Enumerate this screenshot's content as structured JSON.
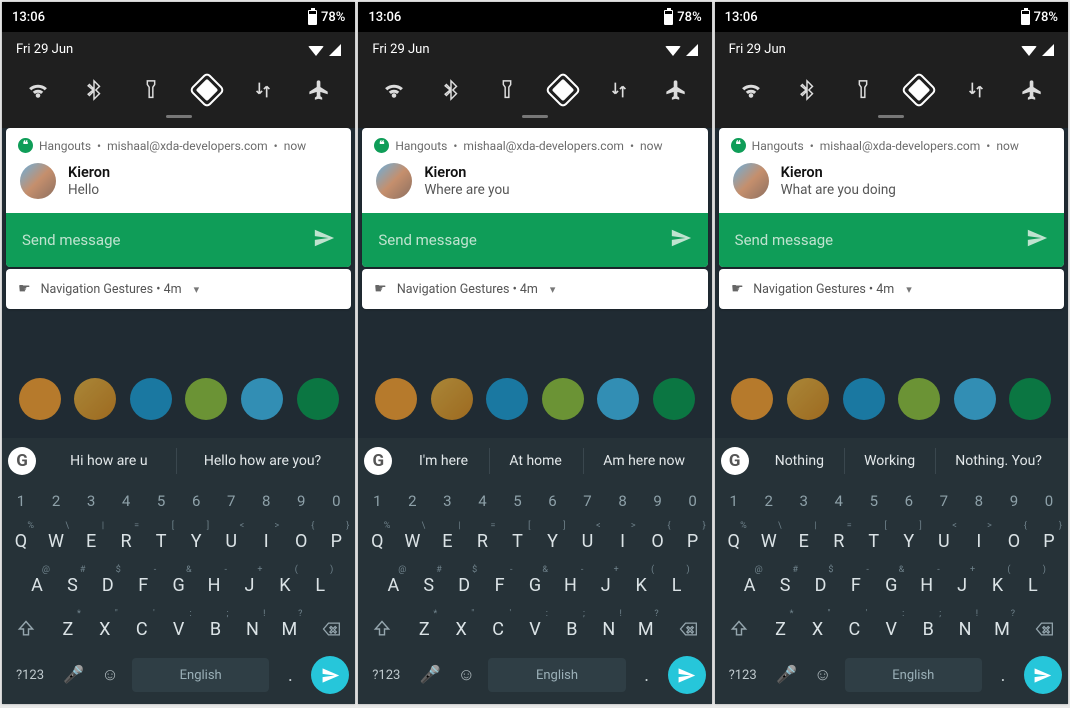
{
  "screens": [
    {
      "status": {
        "time": "13:06",
        "battery": "78%"
      },
      "qs": {
        "date": "Fri 29 Jun"
      },
      "notification": {
        "app": "Hangouts",
        "account": "mishaal@xda-developers.com",
        "when": "now",
        "sender": "Kieron",
        "message": "Hello",
        "reply_placeholder": "Send message"
      },
      "lower": {
        "title": "Navigation Gestures",
        "age": "4m"
      },
      "keyboard": {
        "suggestions": [
          "Hi how are u",
          "Hello how are you?"
        ],
        "numbers": [
          "1",
          "2",
          "3",
          "4",
          "5",
          "6",
          "7",
          "8",
          "9",
          "0"
        ],
        "row1": [
          {
            "k": "Q",
            "h": "%"
          },
          {
            "k": "W",
            "h": "\\"
          },
          {
            "k": "E",
            "h": "|"
          },
          {
            "k": "R",
            "h": "="
          },
          {
            "k": "T",
            "h": "["
          },
          {
            "k": "Y",
            "h": "]"
          },
          {
            "k": "U",
            "h": "<"
          },
          {
            "k": "I",
            "h": ">"
          },
          {
            "k": "O",
            "h": "{"
          },
          {
            "k": "P",
            "h": "}"
          }
        ],
        "row2": [
          {
            "k": "A",
            "h": "@"
          },
          {
            "k": "S",
            "h": "#"
          },
          {
            "k": "D",
            "h": "$"
          },
          {
            "k": "F",
            "h": "-"
          },
          {
            "k": "G",
            "h": "&"
          },
          {
            "k": "H",
            "h": "-"
          },
          {
            "k": "J",
            "h": "+"
          },
          {
            "k": "K",
            "h": "("
          },
          {
            "k": "L",
            "h": ")"
          }
        ],
        "row3": [
          {
            "k": "Z",
            "h": "*"
          },
          {
            "k": "X",
            "h": "\""
          },
          {
            "k": "C",
            "h": "'"
          },
          {
            "k": "V",
            "h": ":"
          },
          {
            "k": "B",
            "h": ";"
          },
          {
            "k": "N",
            "h": "!"
          },
          {
            "k": "M",
            "h": "?"
          }
        ],
        "sym": "?123",
        "space": "English",
        "dot": "."
      }
    },
    {
      "status": {
        "time": "13:06",
        "battery": "78%"
      },
      "qs": {
        "date": "Fri 29 Jun"
      },
      "notification": {
        "app": "Hangouts",
        "account": "mishaal@xda-developers.com",
        "when": "now",
        "sender": "Kieron",
        "message": "Where are you",
        "reply_placeholder": "Send message"
      },
      "lower": {
        "title": "Navigation Gestures",
        "age": "4m"
      },
      "keyboard": {
        "suggestions": [
          "I'm here",
          "At home",
          "Am here now"
        ],
        "numbers": [
          "1",
          "2",
          "3",
          "4",
          "5",
          "6",
          "7",
          "8",
          "9",
          "0"
        ],
        "row1": [
          {
            "k": "Q",
            "h": "%"
          },
          {
            "k": "W",
            "h": "\\"
          },
          {
            "k": "E",
            "h": "|"
          },
          {
            "k": "R",
            "h": "="
          },
          {
            "k": "T",
            "h": "["
          },
          {
            "k": "Y",
            "h": "]"
          },
          {
            "k": "U",
            "h": "<"
          },
          {
            "k": "I",
            "h": ">"
          },
          {
            "k": "O",
            "h": "{"
          },
          {
            "k": "P",
            "h": "}"
          }
        ],
        "row2": [
          {
            "k": "A",
            "h": "@"
          },
          {
            "k": "S",
            "h": "#"
          },
          {
            "k": "D",
            "h": "$"
          },
          {
            "k": "F",
            "h": "-"
          },
          {
            "k": "G",
            "h": "&"
          },
          {
            "k": "H",
            "h": "-"
          },
          {
            "k": "J",
            "h": "+"
          },
          {
            "k": "K",
            "h": "("
          },
          {
            "k": "L",
            "h": ")"
          }
        ],
        "row3": [
          {
            "k": "Z",
            "h": "*"
          },
          {
            "k": "X",
            "h": "\""
          },
          {
            "k": "C",
            "h": "'"
          },
          {
            "k": "V",
            "h": ":"
          },
          {
            "k": "B",
            "h": ";"
          },
          {
            "k": "N",
            "h": "!"
          },
          {
            "k": "M",
            "h": "?"
          }
        ],
        "sym": "?123",
        "space": "English",
        "dot": "."
      }
    },
    {
      "status": {
        "time": "13:06",
        "battery": "78%"
      },
      "qs": {
        "date": "Fri 29 Jun"
      },
      "notification": {
        "app": "Hangouts",
        "account": "mishaal@xda-developers.com",
        "when": "now",
        "sender": "Kieron",
        "message": "What are you doing",
        "reply_placeholder": "Send message"
      },
      "lower": {
        "title": "Navigation Gestures",
        "age": "4m"
      },
      "keyboard": {
        "suggestions": [
          "Nothing",
          "Working",
          "Nothing. You?"
        ],
        "numbers": [
          "1",
          "2",
          "3",
          "4",
          "5",
          "6",
          "7",
          "8",
          "9",
          "0"
        ],
        "row1": [
          {
            "k": "Q",
            "h": "%"
          },
          {
            "k": "W",
            "h": "\\"
          },
          {
            "k": "E",
            "h": "|"
          },
          {
            "k": "R",
            "h": "="
          },
          {
            "k": "T",
            "h": "["
          },
          {
            "k": "Y",
            "h": "]"
          },
          {
            "k": "U",
            "h": "<"
          },
          {
            "k": "I",
            "h": ">"
          },
          {
            "k": "O",
            "h": "{"
          },
          {
            "k": "P",
            "h": "}"
          }
        ],
        "row2": [
          {
            "k": "A",
            "h": "@"
          },
          {
            "k": "S",
            "h": "#"
          },
          {
            "k": "D",
            "h": "$"
          },
          {
            "k": "F",
            "h": "-"
          },
          {
            "k": "G",
            "h": "&"
          },
          {
            "k": "H",
            "h": "-"
          },
          {
            "k": "J",
            "h": "+"
          },
          {
            "k": "K",
            "h": "("
          },
          {
            "k": "L",
            "h": ")"
          }
        ],
        "row3": [
          {
            "k": "Z",
            "h": "*"
          },
          {
            "k": "X",
            "h": "\""
          },
          {
            "k": "C",
            "h": "'"
          },
          {
            "k": "V",
            "h": ":"
          },
          {
            "k": "B",
            "h": ";"
          },
          {
            "k": "N",
            "h": "!"
          },
          {
            "k": "M",
            "h": "?"
          }
        ],
        "sym": "?123",
        "space": "English",
        "dot": "."
      }
    }
  ]
}
